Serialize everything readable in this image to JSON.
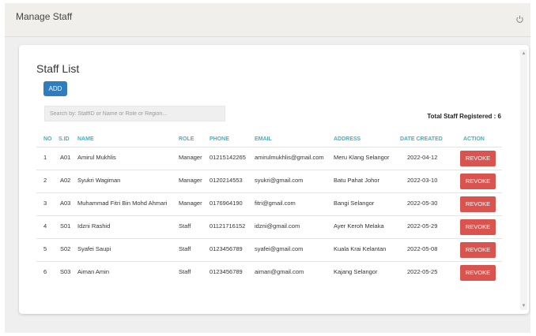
{
  "header": {
    "title": "Manage Staff",
    "logout_icon": "power-icon"
  },
  "card": {
    "title": "Staff List",
    "add_label": "ADD",
    "search_placeholder": "Search by: StaffID or Name or Role or Region...",
    "total_label": "Total Staff Registered : 6"
  },
  "table": {
    "headers": [
      "NO",
      "S.ID",
      "NAME",
      "ROLE",
      "PHONE",
      "EMAIL",
      "ADDRESS",
      "DATE CREATED",
      "ACTION"
    ],
    "rows": [
      {
        "no": "1",
        "sid": "A01",
        "name": "Amirul Mukhlis",
        "role": "Manager",
        "phone": "01215142265",
        "email": "amirulmukhlis@gmail.com",
        "address": "Meru Klang Selangor",
        "date": "2022-04-12",
        "action": "REVOKE"
      },
      {
        "no": "2",
        "sid": "A02",
        "name": "Syukri Wagiman",
        "role": "Manager",
        "phone": "0120214553",
        "email": "syukri@gmail.com",
        "address": "Batu Pahat Johor",
        "date": "2022-03-10",
        "action": "REVOKE"
      },
      {
        "no": "3",
        "sid": "A03",
        "name": "Muhammad Fitri Bin Mohd Ahmari",
        "role": "Manager",
        "phone": "0176964190",
        "email": "fitri@gmail.com",
        "address": "Bangi Selangor",
        "date": "2022-05-30",
        "action": "REVOKE"
      },
      {
        "no": "4",
        "sid": "S01",
        "name": "Idzni Rashid",
        "role": "Staff",
        "phone": "01121716152",
        "email": "idzni@gmail.com",
        "address": "Ayer Keroh Melaka",
        "date": "2022-05-29",
        "action": "REVOKE"
      },
      {
        "no": "5",
        "sid": "S02",
        "name": "Syafei Saupi",
        "role": "Staff",
        "phone": "0123456789",
        "email": "syafei@gmail.com",
        "address": "Kuala Krai Kelantan",
        "date": "2022-05-08",
        "action": "REVOKE"
      },
      {
        "no": "6",
        "sid": "S03",
        "name": "Aiman Amin",
        "role": "Staff",
        "phone": "0123456789",
        "email": "aiman@gmail.com",
        "address": "Kajang Selangor",
        "date": "2022-05-25",
        "action": "REVOKE"
      }
    ]
  },
  "colors": {
    "accent": "#2f7dbe",
    "header_text": "#3ab3c9",
    "danger": "#d9534f"
  }
}
